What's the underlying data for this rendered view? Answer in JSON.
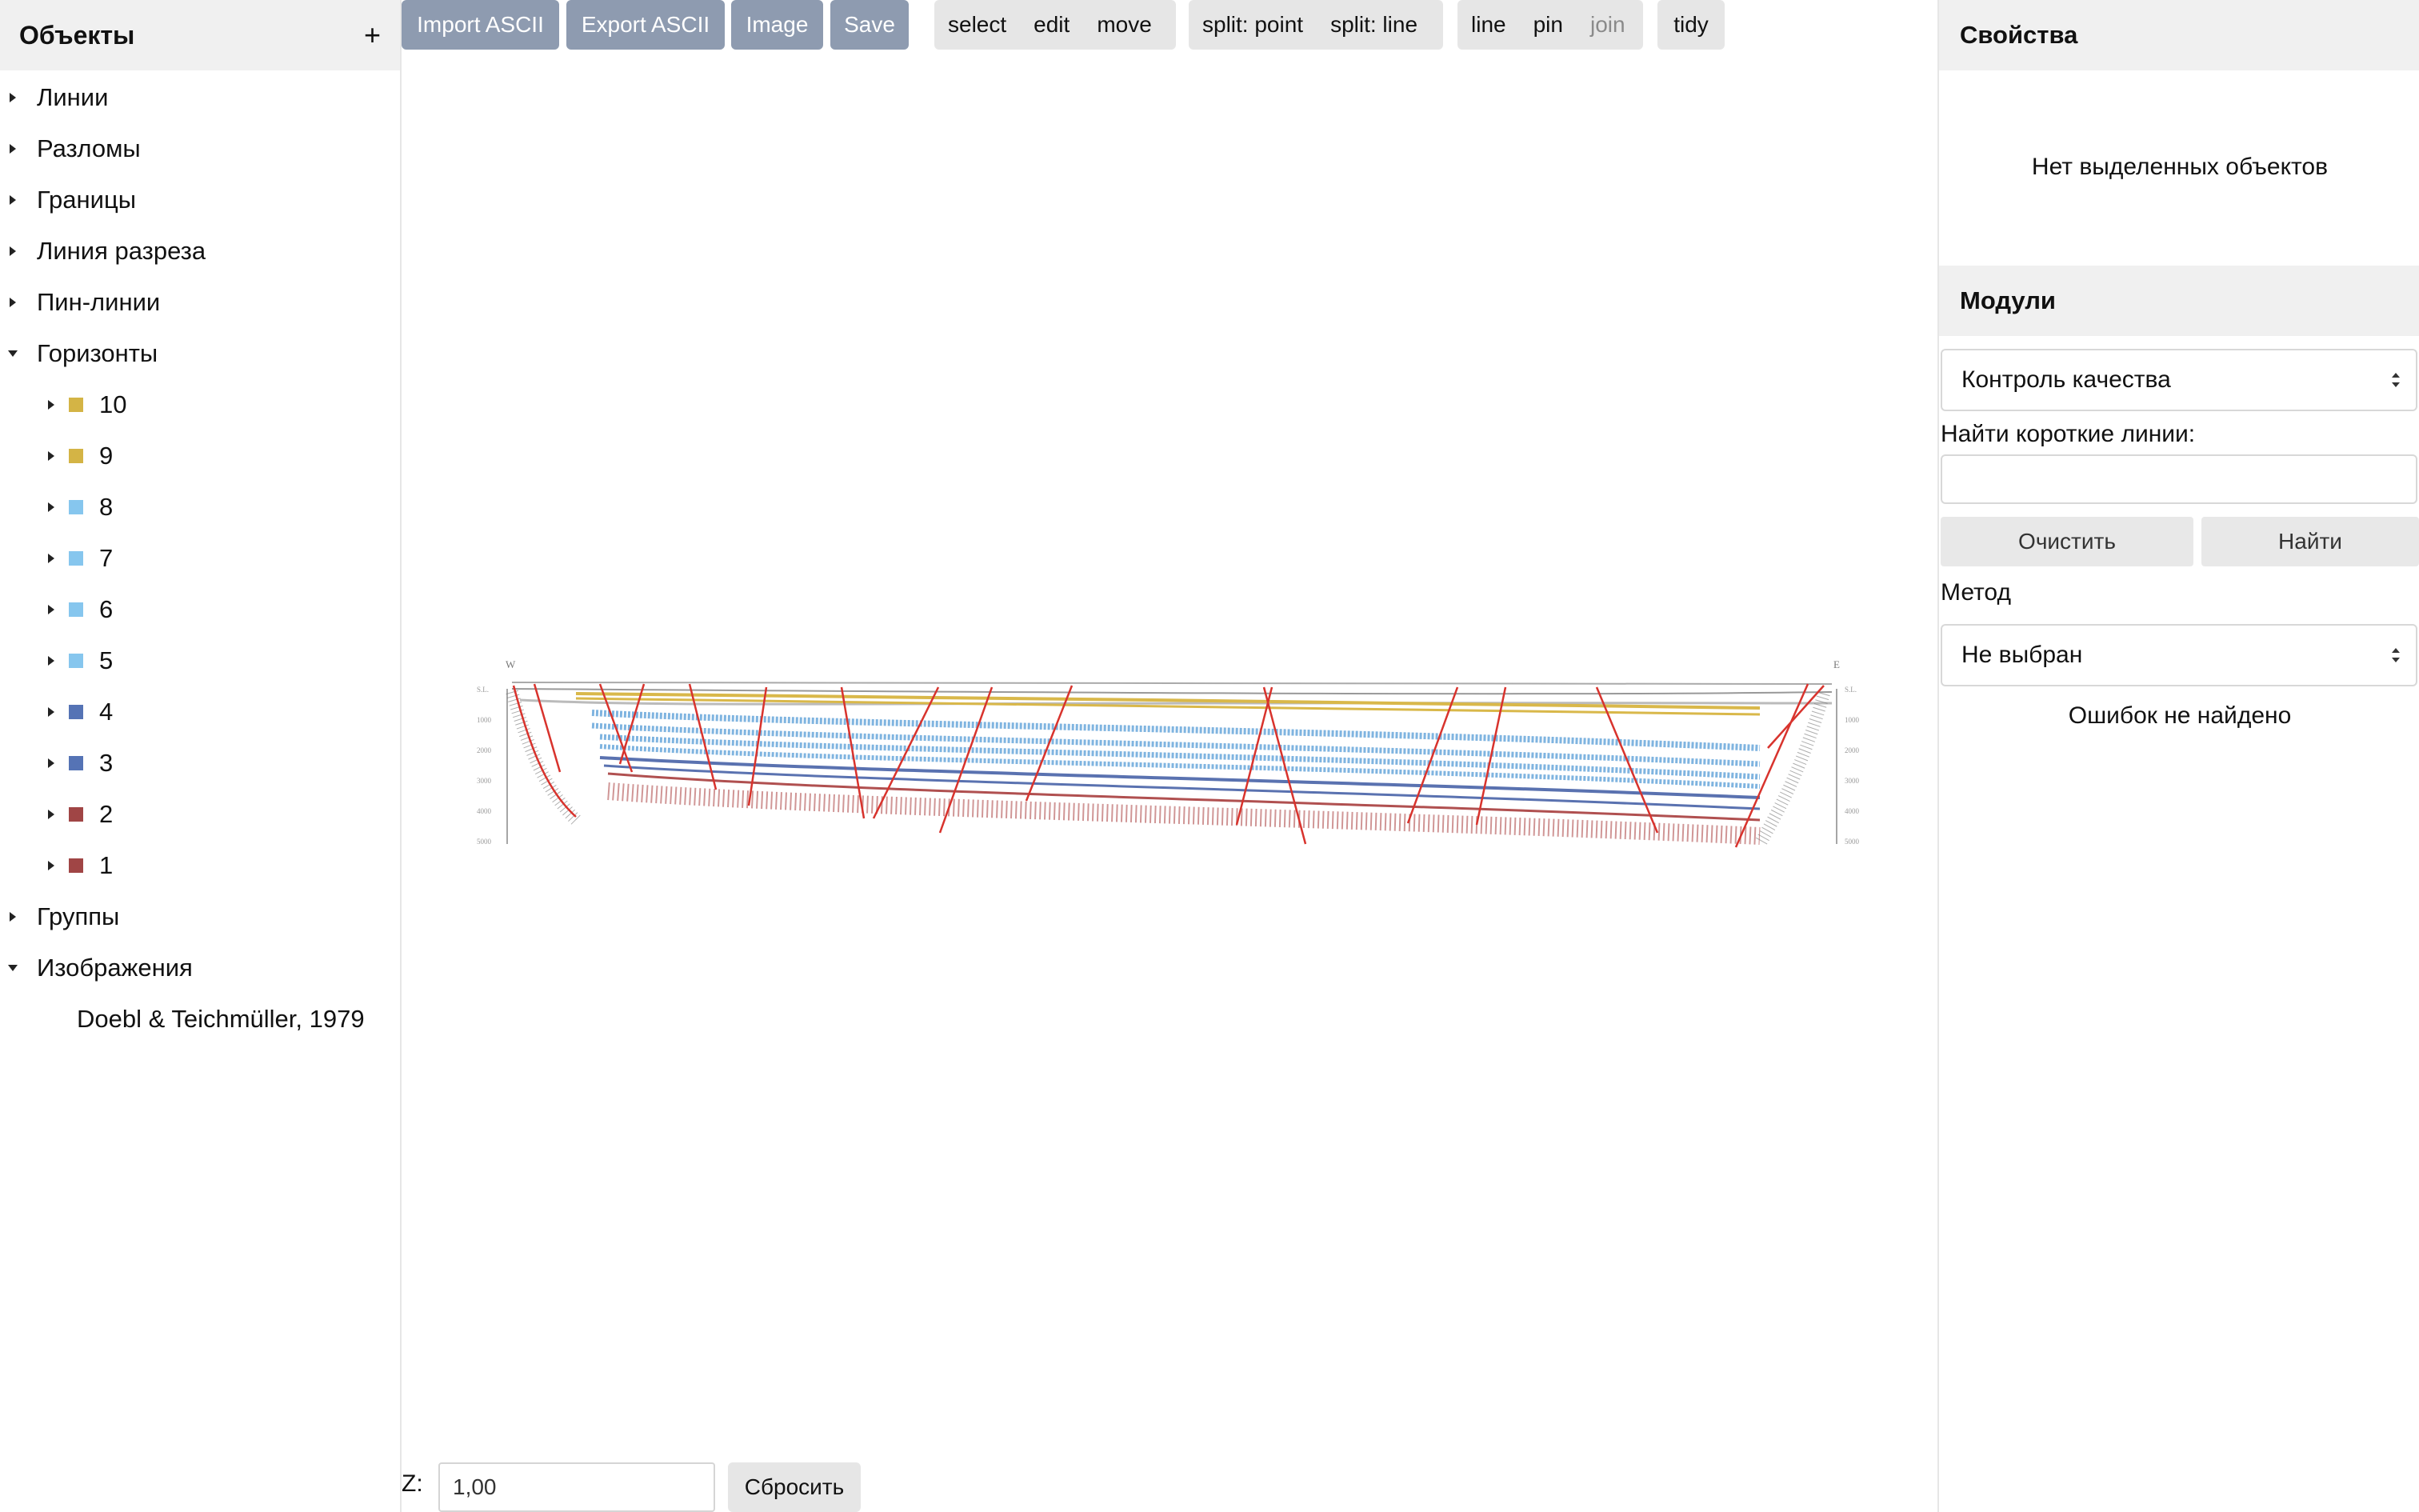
{
  "left_panel": {
    "title": "Объекты",
    "add_label": "+",
    "items": [
      {
        "label": "Линии",
        "expanded": false
      },
      {
        "label": "Разломы",
        "expanded": false
      },
      {
        "label": "Границы",
        "expanded": false
      },
      {
        "label": "Линия разреза",
        "expanded": false
      },
      {
        "label": "Пин-линии",
        "expanded": false
      },
      {
        "label": "Горизонты",
        "expanded": true
      }
    ],
    "horizons": [
      {
        "label": "10",
        "color": "#d4b445"
      },
      {
        "label": "9",
        "color": "#d4b445"
      },
      {
        "label": "8",
        "color": "#86c6ee"
      },
      {
        "label": "7",
        "color": "#86c6ee"
      },
      {
        "label": "6",
        "color": "#86c6ee"
      },
      {
        "label": "5",
        "color": "#86c6ee"
      },
      {
        "label": "4",
        "color": "#5573b5"
      },
      {
        "label": "3",
        "color": "#5573b5"
      },
      {
        "label": "2",
        "color": "#a04545"
      },
      {
        "label": "1",
        "color": "#a04545"
      }
    ],
    "groups_label": "Группы",
    "images_label": "Изображения",
    "image_item": "Doebl & Teichmüller, 1979"
  },
  "toolbar": {
    "import_label": "Import ASCII",
    "export_label": "Export ASCII",
    "image_label": "Image",
    "save_label": "Save",
    "mode_group": [
      "select",
      "edit",
      "move"
    ],
    "split_group": [
      "split: point",
      "split: line"
    ],
    "line_group": [
      "line",
      "pin",
      "join"
    ],
    "tidy_label": "tidy"
  },
  "right_panel": {
    "collapse_label": "v",
    "properties_title": "Свойства",
    "no_selection": "Нет выделенных объектов",
    "modules_title": "Модули",
    "module_select": "Контроль качества",
    "short_lines_label": "Найти короткие линии:",
    "short_lines_value": "",
    "clear_label": "Очистить",
    "find_label": "Найти",
    "method_label": "Метод",
    "method_select": "Не выбран",
    "result_text": "Ошибок не найдено"
  },
  "bottom": {
    "z_label": "Z:",
    "z_value": "1,00",
    "reset_label": "Сбросить"
  },
  "section": {
    "west_label": "W",
    "east_label": "E",
    "left_ticks": [
      "S.L.",
      "1000",
      "2000",
      "3000",
      "4000",
      "5000"
    ],
    "right_ticks": [
      "S.L.",
      "1000",
      "2000",
      "3000",
      "4000",
      "5000"
    ],
    "fault_color": "#d8332d",
    "yellow_color": "#d9b84a",
    "blue_color": "#7fb4e0",
    "darkblue_color": "#5a72b0",
    "red_color": "#b05050"
  }
}
